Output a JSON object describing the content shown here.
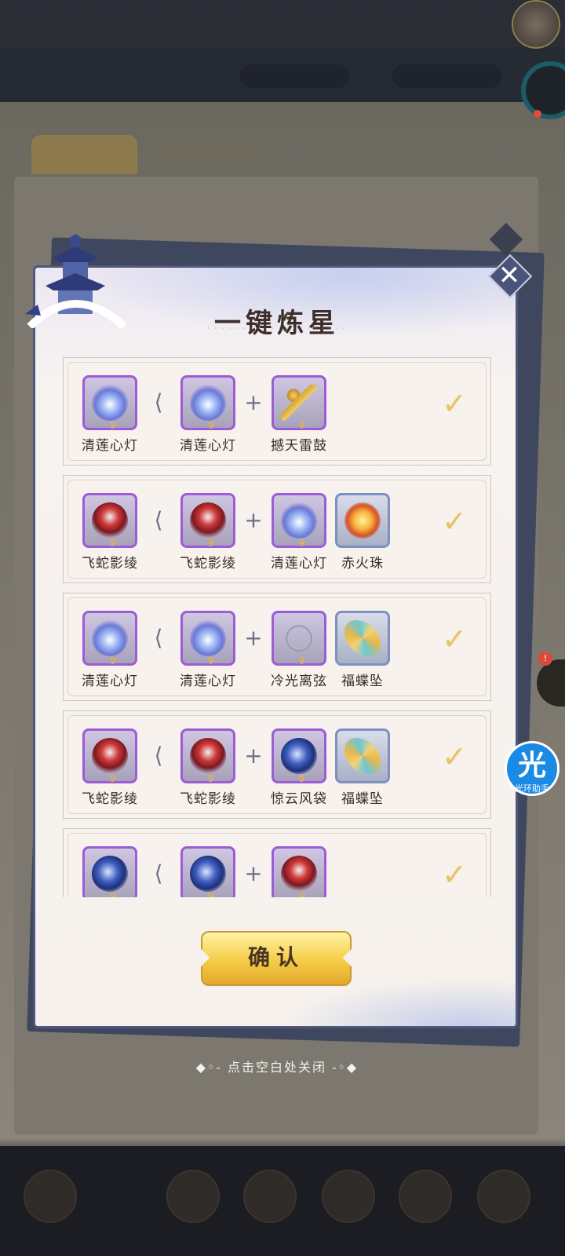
{
  "modal": {
    "title": "一键炼星",
    "close_icon": "close-icon",
    "confirm_label": "确认",
    "hint": "点击空白处关闭"
  },
  "helper": {
    "label": "光环助手",
    "glyph": "光"
  },
  "symbols": {
    "arrow": "⟨",
    "plus": "+",
    "check": "✓",
    "close": "✕",
    "star": "9"
  },
  "rows": [
    {
      "result": {
        "name": "清莲心灯",
        "icon": "lotus-lamp-icon"
      },
      "base": {
        "name": "清莲心灯",
        "icon": "lotus-lamp-icon"
      },
      "materials": [
        {
          "name": "撼天雷鼓",
          "icon": "thunder-drum-hammer-icon"
        }
      ]
    },
    {
      "result": {
        "name": "飞蛇影绫",
        "icon": "flying-snake-ribbon-icon"
      },
      "base": {
        "name": "飞蛇影绫",
        "icon": "flying-snake-ribbon-icon"
      },
      "materials": [
        {
          "name": "清莲心灯",
          "icon": "lotus-lamp-icon"
        },
        {
          "name": "赤火珠",
          "icon": "red-fire-orb-icon"
        }
      ]
    },
    {
      "result": {
        "name": "清莲心灯",
        "icon": "lotus-lamp-icon"
      },
      "base": {
        "name": "清莲心灯",
        "icon": "lotus-lamp-icon"
      },
      "materials": [
        {
          "name": "冷光离弦",
          "icon": "cold-light-bow-icon"
        },
        {
          "name": "福蝶坠",
          "icon": "butterfly-pendant-icon"
        }
      ]
    },
    {
      "result": {
        "name": "飞蛇影绫",
        "icon": "flying-snake-ribbon-icon"
      },
      "base": {
        "name": "飞蛇影绫",
        "icon": "flying-snake-ribbon-icon"
      },
      "materials": [
        {
          "name": "惊云风袋",
          "icon": "cloud-wind-bag-icon"
        },
        {
          "name": "福蝶坠",
          "icon": "butterfly-pendant-icon"
        }
      ]
    },
    {
      "result": {
        "name": "",
        "icon": "cloud-wind-bag-icon"
      },
      "base": {
        "name": "",
        "icon": "cloud-wind-bag-icon"
      },
      "materials": [
        {
          "name": "",
          "icon": "flying-snake-ribbon-icon"
        }
      ]
    }
  ]
}
